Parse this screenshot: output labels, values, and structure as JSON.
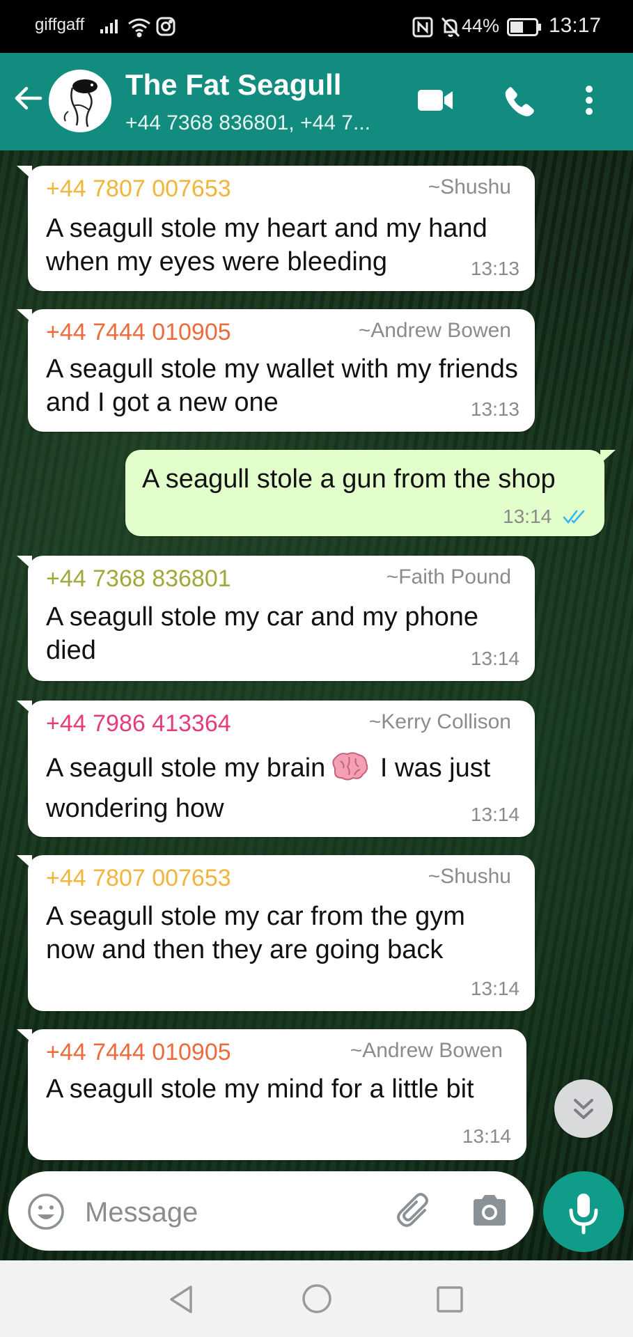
{
  "status_bar": {
    "carrier": "giffgaff",
    "battery_percent": "44%",
    "time": "13:17",
    "icons": [
      "signal-icon",
      "wifi-icon",
      "instagram-icon",
      "nfc-icon",
      "bell-muted-icon",
      "battery-icon"
    ]
  },
  "header": {
    "title": "The Fat Seagull",
    "subtitle": "+44 7368 836801, +44 7...",
    "icons": [
      "back-arrow-icon",
      "video-call-icon",
      "phone-icon",
      "more-vert-icon"
    ]
  },
  "messages": [
    {
      "direction": "in",
      "phone": "+44 7807 007653",
      "name": "~Shushu",
      "text": "A seagull stole my heart and my hand when my eyes were bleeding",
      "time": "13:13",
      "color": "#f2b53c"
    },
    {
      "direction": "in",
      "phone": "+44 7444 010905",
      "name": "~Andrew Bowen",
      "text": "A seagull stole my wallet with my friends and I got a new one",
      "time": "13:13",
      "color": "#ec6b3c"
    },
    {
      "direction": "out",
      "text": "A seagull stole a gun from the shop",
      "time": "13:14",
      "status": "read"
    },
    {
      "direction": "in",
      "phone": "+44 7368 836801",
      "name": "~Faith Pound",
      "text": "A seagull stole my car and my phone died",
      "time": "13:14",
      "color": "#a0a83a"
    },
    {
      "direction": "in",
      "phone": "+44 7986 413364",
      "name": "~Kerry Collison",
      "text_before": "A seagull stole my brain",
      "text_after": "I was just wondering how",
      "emoji": "brain-emoji-icon",
      "time": "13:14",
      "color": "#e63b7a"
    },
    {
      "direction": "in",
      "phone": "+44 7807 007653",
      "name": "~Shushu",
      "text": "A seagull stole my car from the gym now and then they are going back",
      "time": "13:14",
      "color": "#f2b53c"
    },
    {
      "direction": "in",
      "phone": "+44 7444 010905",
      "name": "~Andrew Bowen",
      "text": "A seagull stole my mind for a little bit",
      "time": "13:14",
      "color": "#ec6b3c"
    }
  ],
  "composer": {
    "placeholder": "Message",
    "value": "",
    "icons": [
      "emoji-icon",
      "attach-icon",
      "camera-icon",
      "mic-icon"
    ]
  },
  "nav_bar": {
    "icons": [
      "nav-back-icon",
      "nav-home-icon",
      "nav-recent-icon"
    ]
  },
  "colors": {
    "header_bg": "#128c7e",
    "outgoing_bubble": "#e1fecb",
    "incoming_bubble": "#ffffff",
    "accent": "#0f9d8a",
    "read_ticks": "#34b7f1"
  }
}
